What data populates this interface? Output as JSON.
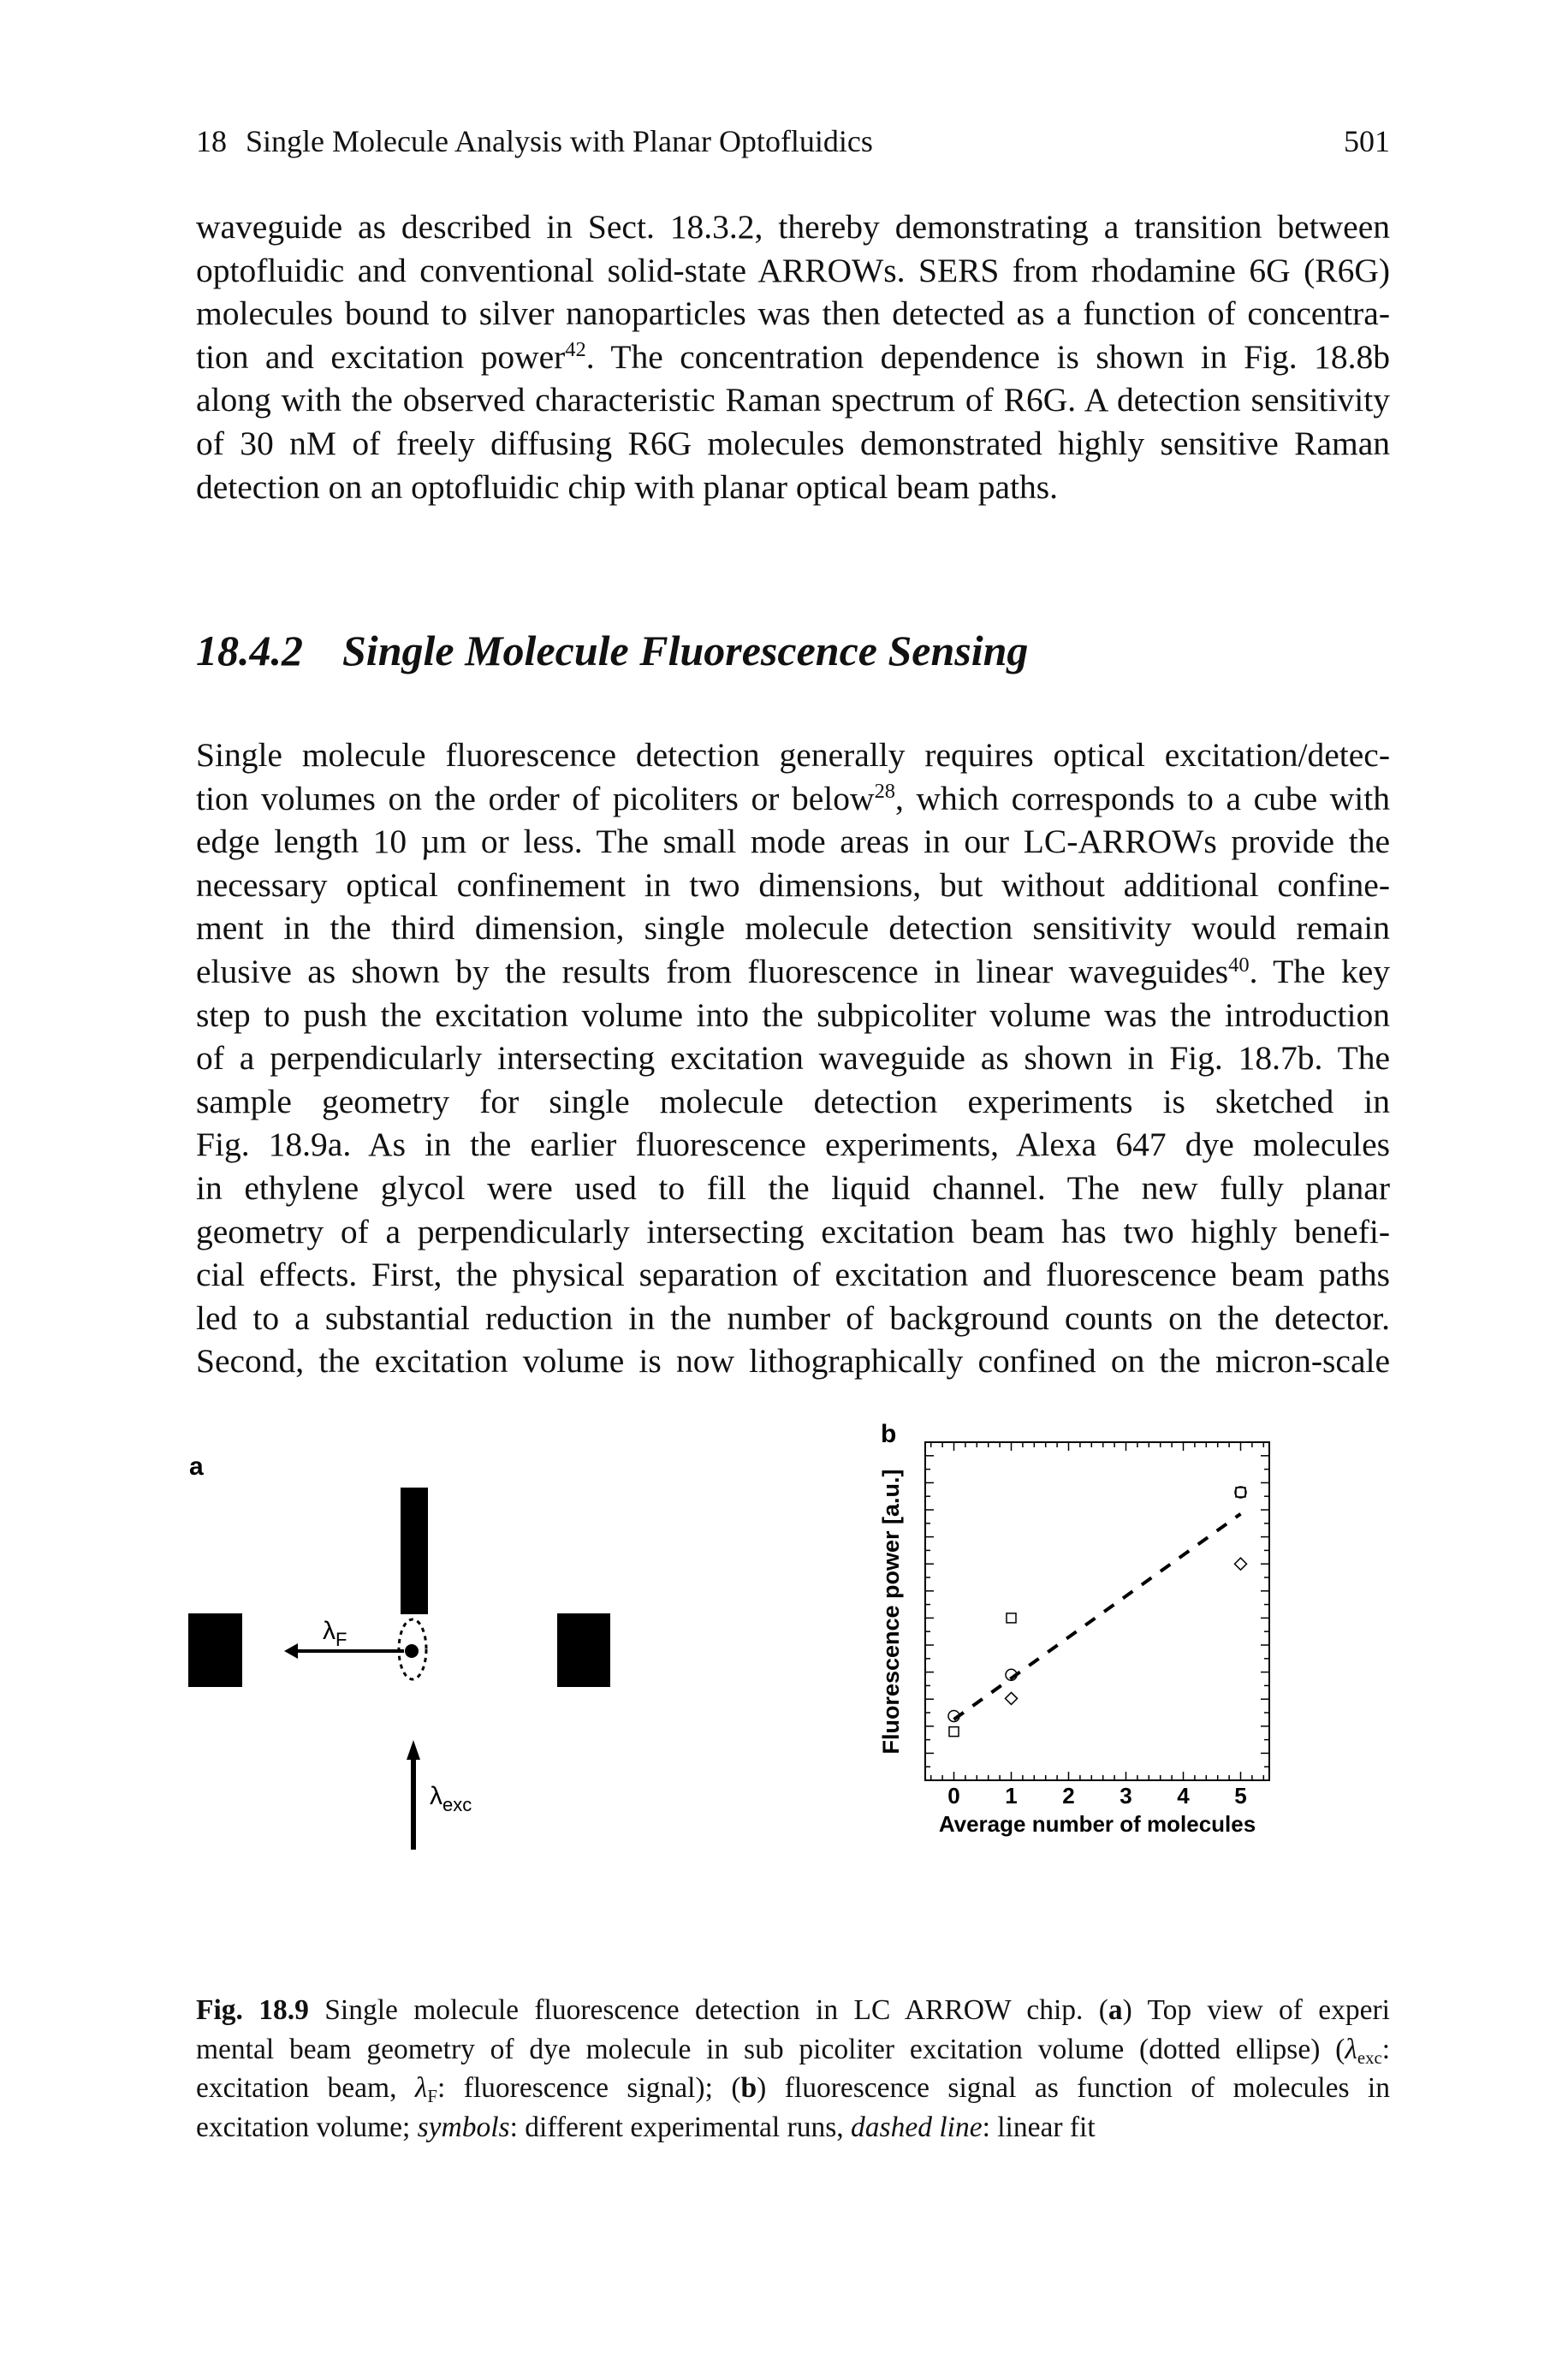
{
  "header": {
    "chapter": "18",
    "title": "Single Molecule Analysis with Planar Optofluidics",
    "page": "501"
  },
  "paragraph1": [
    [
      [
        "waveguide as described in Sect. 18.3.2, thereby demonstrating a transition between",
        ""
      ]
    ],
    [
      [
        "optofluidic and conventional solid-state ARROWs. SERS from rhodamine 6G (R6G)",
        ""
      ]
    ],
    [
      [
        "molecules bound to silver nanoparticles was then detected as a function of concentra-",
        ""
      ]
    ],
    [
      [
        "tion and excitation power",
        ""
      ],
      [
        "42",
        "sup"
      ],
      [
        ". The concentration dependence is shown in Fig. 18.8b",
        ""
      ]
    ],
    [
      [
        "along with the observed characteristic Raman spectrum of R6G. A detection sensitivity",
        ""
      ]
    ],
    [
      [
        "of 30 nM of freely diffusing R6G molecules demonstrated highly sensitive Raman",
        ""
      ]
    ],
    [
      [
        "detection on an optofluidic chip with planar optical beam paths.",
        ""
      ]
    ]
  ],
  "section": {
    "number": "18.4.2",
    "title": "Single Molecule Fluorescence Sensing"
  },
  "paragraph2": [
    [
      [
        "Single molecule fluorescence detection generally requires optical excitation/detec-",
        ""
      ]
    ],
    [
      [
        "tion volumes on the order of picoliters or below",
        ""
      ],
      [
        "28",
        "sup"
      ],
      [
        ", which corresponds to a cube with",
        ""
      ]
    ],
    [
      [
        "edge length 10 µm or less. The small mode areas in our LC-ARROWs provide the",
        ""
      ]
    ],
    [
      [
        "necessary optical confinement in two dimensions, but without additional confine-",
        ""
      ]
    ],
    [
      [
        "ment in the third dimension, single molecule detection sensitivity would remain",
        ""
      ]
    ],
    [
      [
        "elusive as shown by the results from fluorescence in linear waveguides",
        ""
      ],
      [
        "40",
        "sup"
      ],
      [
        ". The key",
        ""
      ]
    ],
    [
      [
        "step to push the excitation volume into the subpicoliter volume was the introduction",
        ""
      ]
    ],
    [
      [
        "of a perpendicularly intersecting excitation waveguide as shown in Fig. 18.7b. The",
        ""
      ]
    ],
    [
      [
        "sample geometry for single molecule detection experiments is sketched in",
        ""
      ]
    ],
    [
      [
        "Fig. 18.9a. As in the earlier fluorescence experiments, Alexa 647 dye molecules",
        ""
      ]
    ],
    [
      [
        "in ethylene glycol were used to fill the liquid channel. The new fully planar",
        ""
      ]
    ],
    [
      [
        "geometry of a perpendicularly intersecting excitation beam has two highly benefi-",
        ""
      ]
    ],
    [
      [
        "cial effects. First, the physical separation of excitation and fluorescence beam paths",
        ""
      ]
    ],
    [
      [
        "led to a substantial reduction in the number of background counts on the detector.",
        ""
      ]
    ],
    [
      [
        "Second, the excitation volume is now lithographically confined on the micron-scale",
        ""
      ]
    ]
  ],
  "figure_a": {
    "panel_label": "a",
    "lambda_f": "λ",
    "lambda_f_sub": "F",
    "lambda_exc": "λ",
    "lambda_exc_sub": "exc"
  },
  "chart_data": {
    "type": "scatter",
    "panel_label": "b",
    "xlabel": "Average number of molecules",
    "ylabel": "Fluorescence power [a.u.]",
    "xlim": [
      -0.5,
      5.5
    ],
    "ylim": [
      0,
      25
    ],
    "x_ticks": [
      "0",
      "1",
      "2",
      "3",
      "4",
      "5"
    ],
    "y_tick_labels_shown": false,
    "grid": false,
    "series": [
      {
        "marker": "circle",
        "points": [
          [
            0,
            4.75
          ],
          [
            1,
            7.8
          ],
          [
            5,
            21.3
          ]
        ]
      },
      {
        "marker": "square",
        "points": [
          [
            0,
            3.6
          ],
          [
            1,
            12.0
          ],
          [
            5,
            21.3
          ]
        ]
      },
      {
        "marker": "diamond",
        "points": [
          [
            1,
            6.05
          ],
          [
            5,
            16.0
          ]
        ]
      }
    ],
    "fit_line": {
      "style": "dashed",
      "from": [
        0,
        4.5
      ],
      "to": [
        5,
        19.7
      ]
    }
  },
  "caption": [
    [
      [
        "Fig. 18.9",
        "b"
      ],
      [
        " Single molecule fluorescence detection in LC ARROW chip. (",
        ""
      ],
      [
        "a",
        "b"
      ],
      [
        ") Top view of experi",
        ""
      ]
    ],
    [
      [
        "mental beam geometry of dye molecule in sub picoliter excitation volume (dotted ellipse) (",
        ""
      ],
      [
        "λ",
        "i"
      ],
      [
        "exc",
        "sub"
      ],
      [
        ":",
        ""
      ]
    ],
    [
      [
        "excitation beam, ",
        ""
      ],
      [
        "λ",
        "i"
      ],
      [
        "F",
        "sub"
      ],
      [
        ": fluorescence signal); (",
        ""
      ],
      [
        "b",
        "b"
      ],
      [
        ") fluorescence signal as function of molecules in",
        ""
      ]
    ],
    [
      [
        "excitation volume; ",
        ""
      ],
      [
        "symbols",
        "i"
      ],
      [
        ": different experimental runs, ",
        ""
      ],
      [
        "dashed line",
        "i"
      ],
      [
        ": linear fit",
        ""
      ]
    ]
  ]
}
